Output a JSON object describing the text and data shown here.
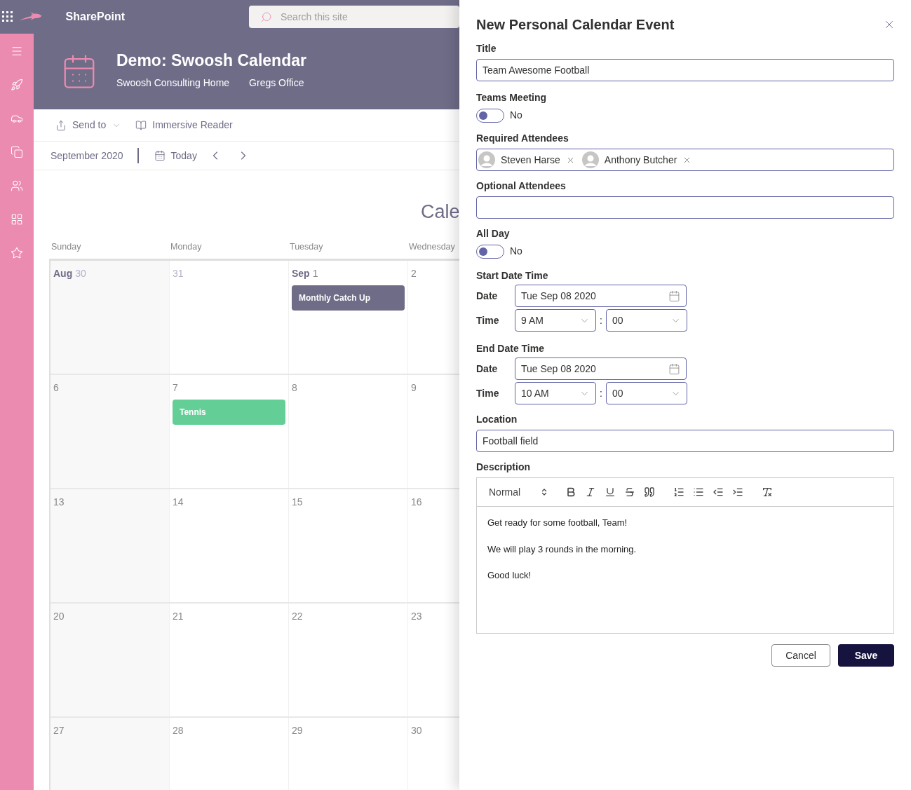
{
  "suite_bar": {
    "app_name": "SharePoint",
    "search": {
      "placeholder": "Search this site"
    }
  },
  "site_header": {
    "title": "Demo: Swoosh Calendar",
    "links": [
      "Swoosh Consulting Home",
      "Gregs Office"
    ]
  },
  "command_bar": [
    {
      "label": "Send to",
      "kind": "share",
      "has_dropdown": true
    },
    {
      "label": "Immersive Reader",
      "kind": "reader",
      "has_dropdown": false
    }
  ],
  "calendar": {
    "month": "September 2020",
    "today": "Today",
    "title": "Cale",
    "weekdays": [
      "Sunday",
      "Monday",
      "Tuesday",
      "Wednesday"
    ],
    "weeks": [
      [
        {
          "month": "Aug",
          "day": "30",
          "other_month": true
        },
        {
          "day": "31",
          "other_month": true
        },
        {
          "month": "Sep",
          "day": "1",
          "other_month": false,
          "events": [
            {
              "title": "Monthly Catch Up",
              "color": "#6e6c87"
            }
          ]
        },
        {
          "day": "2",
          "other_month": false
        }
      ],
      [
        {
          "day": "6",
          "other_month": false
        },
        {
          "day": "7",
          "other_month": false,
          "events": [
            {
              "title": "Tennis",
              "color": "#63cf97"
            }
          ]
        },
        {
          "day": "8",
          "other_month": false
        },
        {
          "day": "9",
          "other_month": false
        }
      ],
      [
        {
          "day": "13",
          "other_month": false
        },
        {
          "day": "14",
          "other_month": false
        },
        {
          "day": "15",
          "other_month": false
        },
        {
          "day": "16",
          "other_month": false
        }
      ],
      [
        {
          "day": "20",
          "other_month": false
        },
        {
          "day": "21",
          "other_month": false
        },
        {
          "day": "22",
          "other_month": false
        },
        {
          "day": "23",
          "other_month": false
        }
      ],
      [
        {
          "day": "27",
          "other_month": false
        },
        {
          "day": "28",
          "other_month": false
        },
        {
          "day": "29",
          "other_month": false
        },
        {
          "day": "30",
          "other_month": false
        }
      ]
    ]
  },
  "panel": {
    "title": "New Personal Calendar Event",
    "title_field": {
      "label": "Title",
      "value": "Team Awesome Football"
    },
    "teams_meeting": {
      "label": "Teams Meeting",
      "on": false,
      "state_text": "No"
    },
    "required_attendees": {
      "label": "Required Attendees",
      "people": [
        "Steven Harse",
        "Anthony Butcher"
      ]
    },
    "optional_attendees": {
      "label": "Optional Attendees"
    },
    "all_day": {
      "label": "All Day",
      "on": false,
      "state_text": "No"
    },
    "start": {
      "label": "Start Date Time",
      "date_label": "Date",
      "date": "Tue Sep 08 2020",
      "time_label": "Time",
      "hour": "9 AM",
      "separator": ":",
      "minute": "00"
    },
    "end": {
      "label": "End Date Time",
      "date_label": "Date",
      "date": "Tue Sep 08 2020",
      "time_label": "Time",
      "hour": "10 AM",
      "separator": ":",
      "minute": "00"
    },
    "location": {
      "label": "Location",
      "value": "Football field"
    },
    "description": {
      "label": "Description",
      "style": "Normal",
      "paragraphs": [
        "Get ready for some football, Team!",
        "We will play 3 rounds in the morning.",
        "Good luck!"
      ]
    },
    "buttons": {
      "cancel": "Cancel",
      "save": "Save"
    }
  }
}
